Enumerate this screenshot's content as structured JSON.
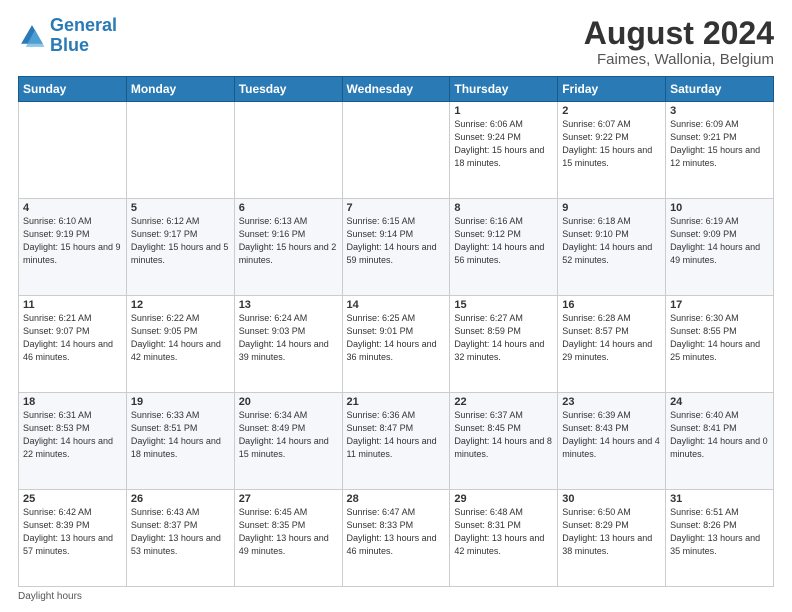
{
  "logo": {
    "line1": "General",
    "line2": "Blue"
  },
  "title": "August 2024",
  "subtitle": "Faimes, Wallonia, Belgium",
  "days_of_week": [
    "Sunday",
    "Monday",
    "Tuesday",
    "Wednesday",
    "Thursday",
    "Friday",
    "Saturday"
  ],
  "footer_note": "Daylight hours",
  "weeks": [
    [
      {
        "day": "",
        "sunrise": "",
        "sunset": "",
        "daylight": ""
      },
      {
        "day": "",
        "sunrise": "",
        "sunset": "",
        "daylight": ""
      },
      {
        "day": "",
        "sunrise": "",
        "sunset": "",
        "daylight": ""
      },
      {
        "day": "",
        "sunrise": "",
        "sunset": "",
        "daylight": ""
      },
      {
        "day": "1",
        "sunrise": "Sunrise: 6:06 AM",
        "sunset": "Sunset: 9:24 PM",
        "daylight": "Daylight: 15 hours and 18 minutes."
      },
      {
        "day": "2",
        "sunrise": "Sunrise: 6:07 AM",
        "sunset": "Sunset: 9:22 PM",
        "daylight": "Daylight: 15 hours and 15 minutes."
      },
      {
        "day": "3",
        "sunrise": "Sunrise: 6:09 AM",
        "sunset": "Sunset: 9:21 PM",
        "daylight": "Daylight: 15 hours and 12 minutes."
      }
    ],
    [
      {
        "day": "4",
        "sunrise": "Sunrise: 6:10 AM",
        "sunset": "Sunset: 9:19 PM",
        "daylight": "Daylight: 15 hours and 9 minutes."
      },
      {
        "day": "5",
        "sunrise": "Sunrise: 6:12 AM",
        "sunset": "Sunset: 9:17 PM",
        "daylight": "Daylight: 15 hours and 5 minutes."
      },
      {
        "day": "6",
        "sunrise": "Sunrise: 6:13 AM",
        "sunset": "Sunset: 9:16 PM",
        "daylight": "Daylight: 15 hours and 2 minutes."
      },
      {
        "day": "7",
        "sunrise": "Sunrise: 6:15 AM",
        "sunset": "Sunset: 9:14 PM",
        "daylight": "Daylight: 14 hours and 59 minutes."
      },
      {
        "day": "8",
        "sunrise": "Sunrise: 6:16 AM",
        "sunset": "Sunset: 9:12 PM",
        "daylight": "Daylight: 14 hours and 56 minutes."
      },
      {
        "day": "9",
        "sunrise": "Sunrise: 6:18 AM",
        "sunset": "Sunset: 9:10 PM",
        "daylight": "Daylight: 14 hours and 52 minutes."
      },
      {
        "day": "10",
        "sunrise": "Sunrise: 6:19 AM",
        "sunset": "Sunset: 9:09 PM",
        "daylight": "Daylight: 14 hours and 49 minutes."
      }
    ],
    [
      {
        "day": "11",
        "sunrise": "Sunrise: 6:21 AM",
        "sunset": "Sunset: 9:07 PM",
        "daylight": "Daylight: 14 hours and 46 minutes."
      },
      {
        "day": "12",
        "sunrise": "Sunrise: 6:22 AM",
        "sunset": "Sunset: 9:05 PM",
        "daylight": "Daylight: 14 hours and 42 minutes."
      },
      {
        "day": "13",
        "sunrise": "Sunrise: 6:24 AM",
        "sunset": "Sunset: 9:03 PM",
        "daylight": "Daylight: 14 hours and 39 minutes."
      },
      {
        "day": "14",
        "sunrise": "Sunrise: 6:25 AM",
        "sunset": "Sunset: 9:01 PM",
        "daylight": "Daylight: 14 hours and 36 minutes."
      },
      {
        "day": "15",
        "sunrise": "Sunrise: 6:27 AM",
        "sunset": "Sunset: 8:59 PM",
        "daylight": "Daylight: 14 hours and 32 minutes."
      },
      {
        "day": "16",
        "sunrise": "Sunrise: 6:28 AM",
        "sunset": "Sunset: 8:57 PM",
        "daylight": "Daylight: 14 hours and 29 minutes."
      },
      {
        "day": "17",
        "sunrise": "Sunrise: 6:30 AM",
        "sunset": "Sunset: 8:55 PM",
        "daylight": "Daylight: 14 hours and 25 minutes."
      }
    ],
    [
      {
        "day": "18",
        "sunrise": "Sunrise: 6:31 AM",
        "sunset": "Sunset: 8:53 PM",
        "daylight": "Daylight: 14 hours and 22 minutes."
      },
      {
        "day": "19",
        "sunrise": "Sunrise: 6:33 AM",
        "sunset": "Sunset: 8:51 PM",
        "daylight": "Daylight: 14 hours and 18 minutes."
      },
      {
        "day": "20",
        "sunrise": "Sunrise: 6:34 AM",
        "sunset": "Sunset: 8:49 PM",
        "daylight": "Daylight: 14 hours and 15 minutes."
      },
      {
        "day": "21",
        "sunrise": "Sunrise: 6:36 AM",
        "sunset": "Sunset: 8:47 PM",
        "daylight": "Daylight: 14 hours and 11 minutes."
      },
      {
        "day": "22",
        "sunrise": "Sunrise: 6:37 AM",
        "sunset": "Sunset: 8:45 PM",
        "daylight": "Daylight: 14 hours and 8 minutes."
      },
      {
        "day": "23",
        "sunrise": "Sunrise: 6:39 AM",
        "sunset": "Sunset: 8:43 PM",
        "daylight": "Daylight: 14 hours and 4 minutes."
      },
      {
        "day": "24",
        "sunrise": "Sunrise: 6:40 AM",
        "sunset": "Sunset: 8:41 PM",
        "daylight": "Daylight: 14 hours and 0 minutes."
      }
    ],
    [
      {
        "day": "25",
        "sunrise": "Sunrise: 6:42 AM",
        "sunset": "Sunset: 8:39 PM",
        "daylight": "Daylight: 13 hours and 57 minutes."
      },
      {
        "day": "26",
        "sunrise": "Sunrise: 6:43 AM",
        "sunset": "Sunset: 8:37 PM",
        "daylight": "Daylight: 13 hours and 53 minutes."
      },
      {
        "day": "27",
        "sunrise": "Sunrise: 6:45 AM",
        "sunset": "Sunset: 8:35 PM",
        "daylight": "Daylight: 13 hours and 49 minutes."
      },
      {
        "day": "28",
        "sunrise": "Sunrise: 6:47 AM",
        "sunset": "Sunset: 8:33 PM",
        "daylight": "Daylight: 13 hours and 46 minutes."
      },
      {
        "day": "29",
        "sunrise": "Sunrise: 6:48 AM",
        "sunset": "Sunset: 8:31 PM",
        "daylight": "Daylight: 13 hours and 42 minutes."
      },
      {
        "day": "30",
        "sunrise": "Sunrise: 6:50 AM",
        "sunset": "Sunset: 8:29 PM",
        "daylight": "Daylight: 13 hours and 38 minutes."
      },
      {
        "day": "31",
        "sunrise": "Sunrise: 6:51 AM",
        "sunset": "Sunset: 8:26 PM",
        "daylight": "Daylight: 13 hours and 35 minutes."
      }
    ]
  ]
}
